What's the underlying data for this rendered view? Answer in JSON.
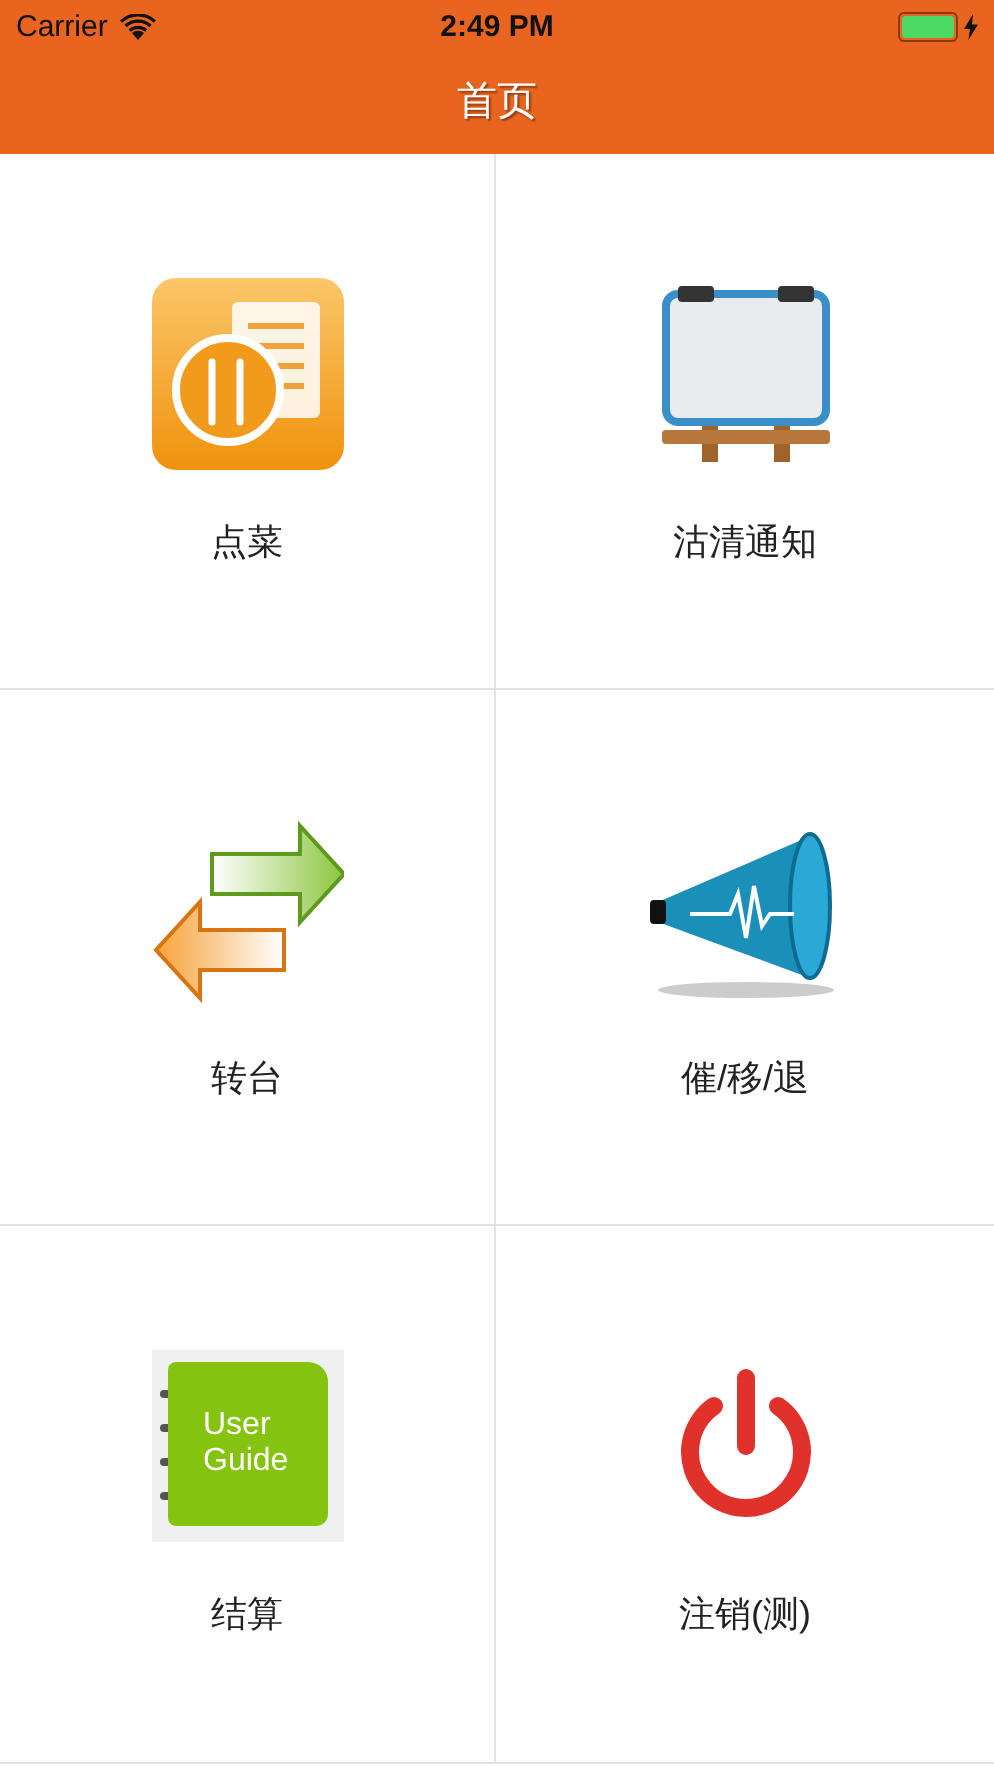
{
  "status_bar": {
    "carrier": "Carrier",
    "time": "2:49 PM",
    "battery": {
      "level": 1.0,
      "charging": true
    }
  },
  "nav_bar": {
    "title": "首页"
  },
  "tiles": [
    {
      "kind": "menu",
      "label": "点菜"
    },
    {
      "kind": "board",
      "label": "沽清通知"
    },
    {
      "kind": "transfer",
      "label": "转台"
    },
    {
      "kind": "megaphone",
      "label": "催/移/退"
    },
    {
      "kind": "guide",
      "label": "结算",
      "icon_text": [
        "User",
        "Guide"
      ]
    },
    {
      "kind": "power",
      "label": "注销(测)"
    }
  ]
}
